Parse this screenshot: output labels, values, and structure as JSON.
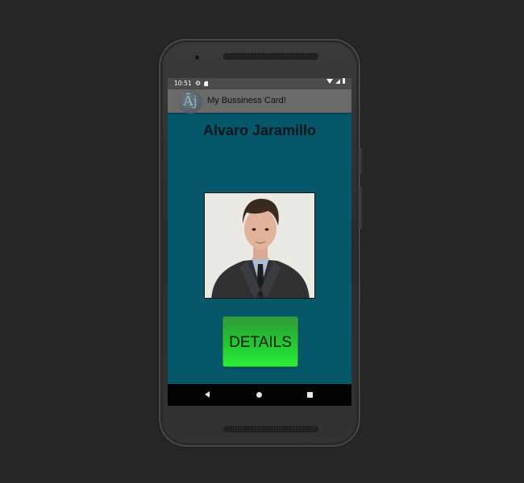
{
  "status_bar": {
    "time": "10:51",
    "left_icons": [
      "gear-icon",
      "sd-card-icon"
    ],
    "right_icons": [
      "wifi-icon",
      "signal-icon",
      "battery-icon"
    ]
  },
  "app_bar": {
    "logo_text": "Āj",
    "title": "My Bussiness Card!"
  },
  "card": {
    "name": "Alvaro Jaramillo",
    "photo": "profile-photo",
    "button_label": "DETAILS"
  },
  "nav_bar": {
    "buttons": [
      "back",
      "home",
      "recents"
    ]
  },
  "colors": {
    "screen_background": "#07576a",
    "app_bar": "#6a6a6a",
    "status_bar": "#4b4b4b",
    "button_green": "#2bee3a",
    "nav_bar": "#020202"
  }
}
